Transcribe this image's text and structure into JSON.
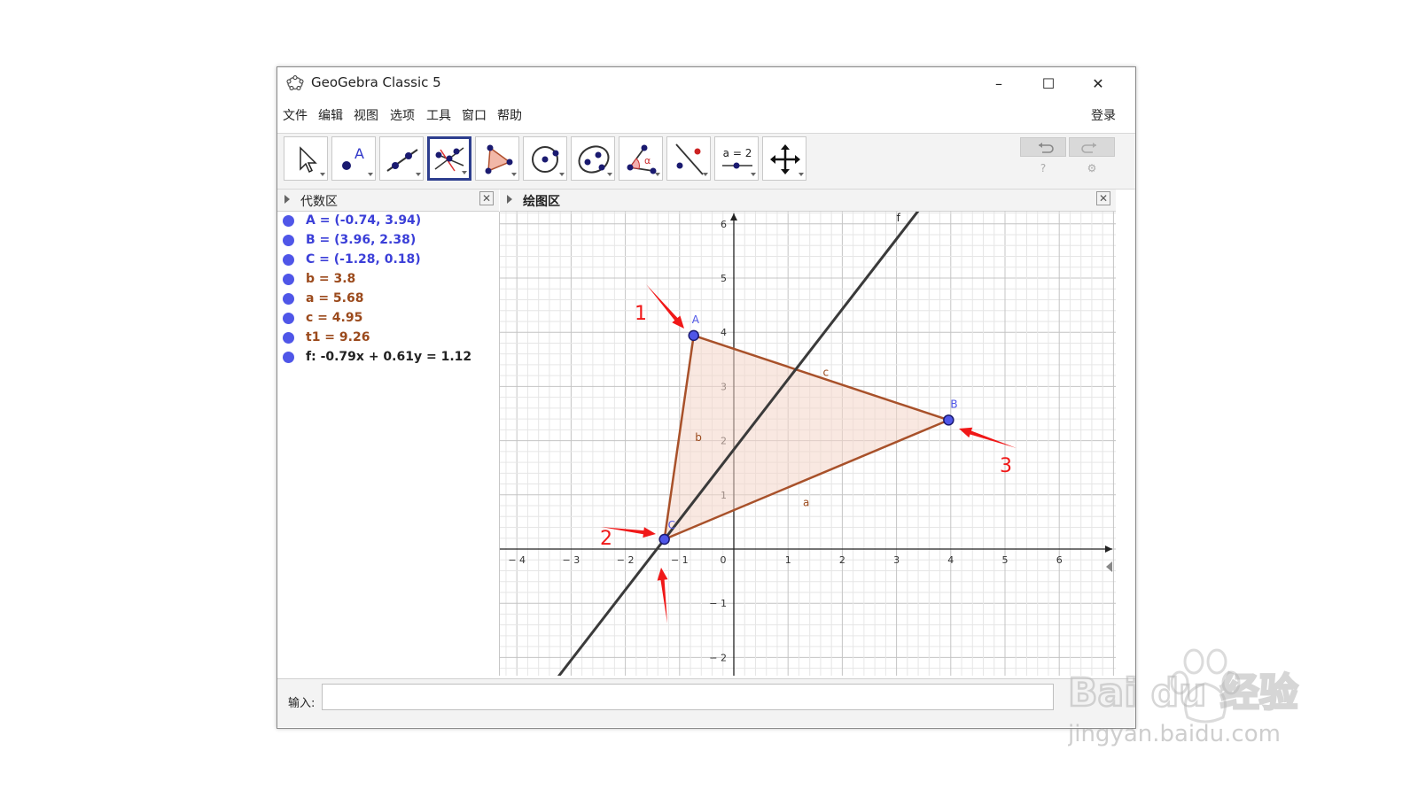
{
  "window": {
    "title": "GeoGebra Classic 5",
    "minimize": "–",
    "maximize": "☐",
    "close": "✕"
  },
  "menu": {
    "items": [
      "文件",
      "编辑",
      "视图",
      "选项",
      "工具",
      "窗口",
      "帮助"
    ],
    "login": "登录"
  },
  "toolbar": {
    "tools": [
      "move-tool",
      "point-tool",
      "line-tool",
      "perpendicular-tool",
      "polygon-tool",
      "circle-tool",
      "conic-tool",
      "angle-tool",
      "reflect-tool",
      "slider-tool",
      "move-graphics-tool"
    ],
    "slider_label": "a = 2",
    "active_tool": "perpendicular-tool"
  },
  "algebra_view": {
    "title": "代数区",
    "close": "✕",
    "items": [
      {
        "text": "A = (-0.74, 3.94)",
        "color": "#3b3fd8"
      },
      {
        "text": "B = (3.96, 2.38)",
        "color": "#3b3fd8"
      },
      {
        "text": "C = (-1.28, 0.18)",
        "color": "#3b3fd8"
      },
      {
        "text": "b = 3.8",
        "color": "#9b4a1c"
      },
      {
        "text": "a = 5.68",
        "color": "#9b4a1c"
      },
      {
        "text": "c = 4.95",
        "color": "#9b4a1c"
      },
      {
        "text": "t1 = 9.26",
        "color": "#9b4a1c"
      },
      {
        "text": "f: -0.79x + 0.61y = 1.12",
        "color": "#222222"
      }
    ]
  },
  "graphics_view": {
    "title": "绘图区",
    "close": "✕",
    "x_ticks": [
      -4,
      -3,
      -2,
      -1,
      0,
      1,
      2,
      3,
      4,
      5,
      6
    ],
    "y_ticks": [
      -2,
      -1,
      1,
      2,
      3,
      4,
      5,
      6
    ],
    "points": [
      {
        "name": "A",
        "x": -0.74,
        "y": 3.94
      },
      {
        "name": "B",
        "x": 3.96,
        "y": 2.38
      },
      {
        "name": "C",
        "x": -1.28,
        "y": 0.18
      }
    ],
    "segment_labels": [
      "a",
      "b",
      "c"
    ],
    "line_label": "f",
    "line": {
      "a": -0.79,
      "b": 0.61,
      "c": 1.12
    },
    "annotations": [
      "1",
      "2",
      "3"
    ]
  },
  "input_bar": {
    "label": "输入:",
    "value": ""
  },
  "watermark": {
    "brand": "Bai du 经验",
    "url": "jingyan.baidu.com"
  }
}
